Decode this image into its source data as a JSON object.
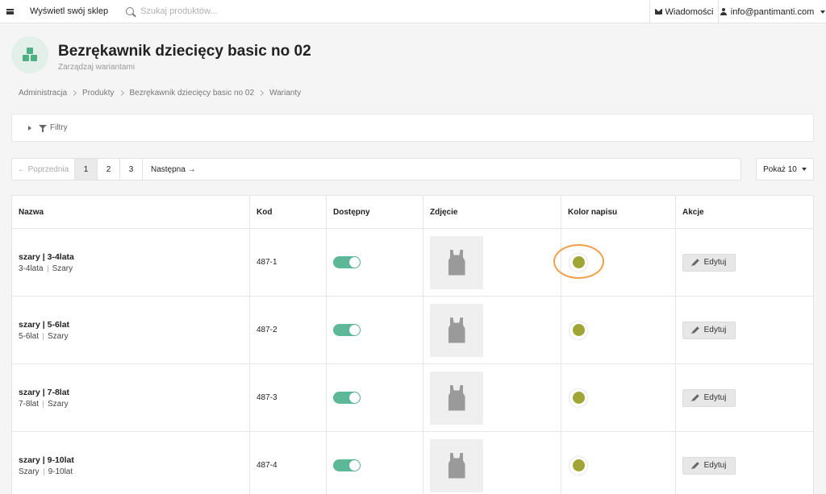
{
  "topbar": {
    "shop_link": "Wyświetl swój sklep",
    "search_placeholder": "Szukaj produktów...",
    "messages": "Wiadomości",
    "account": "info@pantimanti.com"
  },
  "header": {
    "title": "Bezrękawnik dziecięcy basic no 02",
    "subtitle": "Zarządzaj wariantami"
  },
  "breadcrumb": [
    "Administracja",
    "Produkty",
    "Bezrękawnik dziecięcy basic no 02",
    "Warianty"
  ],
  "filters": {
    "label": "Filtry"
  },
  "pagination": {
    "prev": "← Poprzednia",
    "pages": [
      "1",
      "2",
      "3"
    ],
    "active_page": "1",
    "next": "Następna →",
    "per_page": "Pokaż 10"
  },
  "table": {
    "columns": [
      "Nazwa",
      "Kod",
      "Dostępny",
      "Zdjęcie",
      "Kolor napisu",
      "Akcje"
    ],
    "rows": [
      {
        "name": "szary | 3-4lata",
        "tag1": "3-4lata",
        "tag2": "Szary",
        "code": "487-1",
        "available": true,
        "color": "#a0a536",
        "action": "Edytuj"
      },
      {
        "name": "szary | 5-6lat",
        "tag1": "5-6lat",
        "tag2": "Szary",
        "code": "487-2",
        "available": true,
        "color": "#a0a536",
        "action": "Edytuj"
      },
      {
        "name": "szary | 7-8lat",
        "tag1": "7-8lat",
        "tag2": "Szary",
        "code": "487-3",
        "available": true,
        "color": "#a0a536",
        "action": "Edytuj"
      },
      {
        "name": "szary | 9-10lat",
        "tag1": "Szary",
        "tag2": "9-10lat",
        "code": "487-4",
        "available": true,
        "color": "#a0a536",
        "action": "Edytuj"
      }
    ]
  },
  "colors": {
    "accent_green": "#5cb896",
    "text_color_swatch": "#a0a536",
    "highlight_ring": "#f0a04b"
  }
}
